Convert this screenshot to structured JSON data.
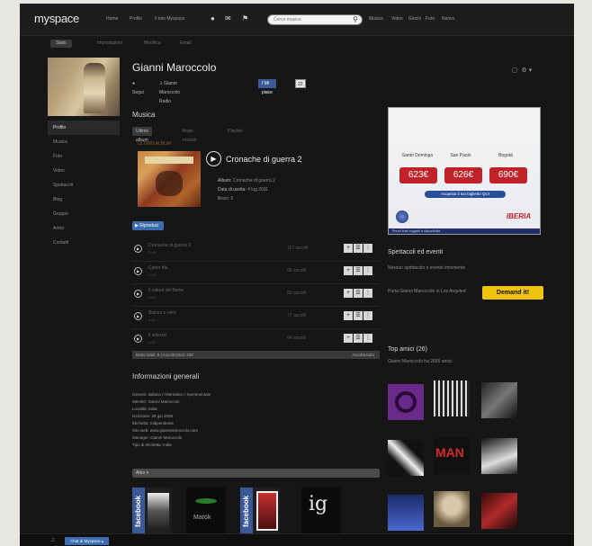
{
  "nav": {
    "logo": "myspace",
    "items": [
      "Home",
      "Profilo",
      "Il mio Myspace"
    ],
    "search_placeholder": "Cerca musica",
    "right_items": [
      "Musica",
      "Video",
      "Giochi",
      "Foto",
      "Nuovo"
    ]
  },
  "subnav": {
    "tabs": [
      "Stato",
      "Impostazioni",
      "Modifica",
      "Email"
    ]
  },
  "profile": {
    "name": "Gianni Maroccolo",
    "follow_label": "Segui",
    "fan_label": "Gianni Maroccolo Radio",
    "fb_label": "Mi piace",
    "fb_count": "22"
  },
  "sidebar": {
    "items": [
      "Profilo",
      "Musica",
      "Foto",
      "Video",
      "Spettacoli",
      "Blog",
      "Gruppo",
      "Amici",
      "Contatti"
    ]
  },
  "music": {
    "section_title": "Musica",
    "tabs": [
      "Ultimo album",
      "Brani recenti",
      "Playlist"
    ],
    "album_label": "ULTIMO ALBUM",
    "album_title": "Cronache di guerra 2",
    "album_meta": {
      "album_label": "Album:",
      "album_value": "Cronache di guerra 2",
      "date_label": "Data di uscita:",
      "date_value": "4 lug 2011",
      "tracks_label": "Brani: 5"
    },
    "shuffle_label": "Riproduci",
    "tracks": [
      {
        "name": "Cronache di guerra 2",
        "sub": "3:48",
        "count": "117 ascolti"
      },
      {
        "name": "Canto blu",
        "sub": "4:12",
        "count": "95 ascolti"
      },
      {
        "name": "Il calore del fiume",
        "sub": "3:55",
        "count": "82 ascolti"
      },
      {
        "name": "Bianco e nero",
        "sub": "5:01",
        "count": "77 ascolti"
      },
      {
        "name": "Il silenzio",
        "sub": "4:30",
        "count": "64 ascolti"
      }
    ],
    "listen_bar": "Brani totali: 5  |  Ascolti totali: 435",
    "listen_all": "Ascolta tutto"
  },
  "info": {
    "title": "Informazioni generali",
    "lines": [
      {
        "label": "Genere:",
        "value": "Italiano / Alternativo / Sperimentale"
      },
      {
        "label": "Membri:",
        "value": "Gianni Maroccolo"
      },
      {
        "label": "Località:",
        "value": "Italia"
      },
      {
        "label": "Iscrizione:",
        "value": "28 giu 2005"
      },
      {
        "label": "Etichetta:",
        "value": "Indipendente"
      },
      {
        "label": "Sito web:",
        "value": "www.giannimaroccolo.com"
      },
      {
        "label": "Manager:",
        "value": "Gianni Maroccolo"
      },
      {
        "label": "Tipo di etichetta:",
        "value": "Indie"
      }
    ],
    "altro_label": "Altro"
  },
  "ad": {
    "cities": [
      "Santo Domingo",
      "San Paolo",
      "Bogotà"
    ],
    "prices": [
      "623€",
      "626€",
      "690€"
    ],
    "cta": "Acquista il tuo biglietto QUI",
    "airline": "IBERIA",
    "footer": "Prezzi finali soggetti a disponibilità"
  },
  "right": {
    "events_title": "Spettacoli ed eventi",
    "events_text": "Nessun spettacolo o evento imminente",
    "demand_text": "Porta Gianni Maroccolo in Los Angeles!",
    "demand_btn": "Demand it!",
    "friends_title": "Top amici (26)",
    "friends_sub": "Gianni Maroccolo ha 2656 amici"
  },
  "thumbs": {
    "fb1": "facebook",
    "marok": "Marok",
    "fb2": "facebook",
    "ig": "ig"
  },
  "bottom": {
    "chat_label": "Chat di Myspace"
  },
  "colors": {
    "background": "#161616",
    "accent_blue": "#3b6db0",
    "facebook": "#3b5998",
    "demand_yellow": "#f1c40f",
    "ad_red": "#c0222a"
  }
}
